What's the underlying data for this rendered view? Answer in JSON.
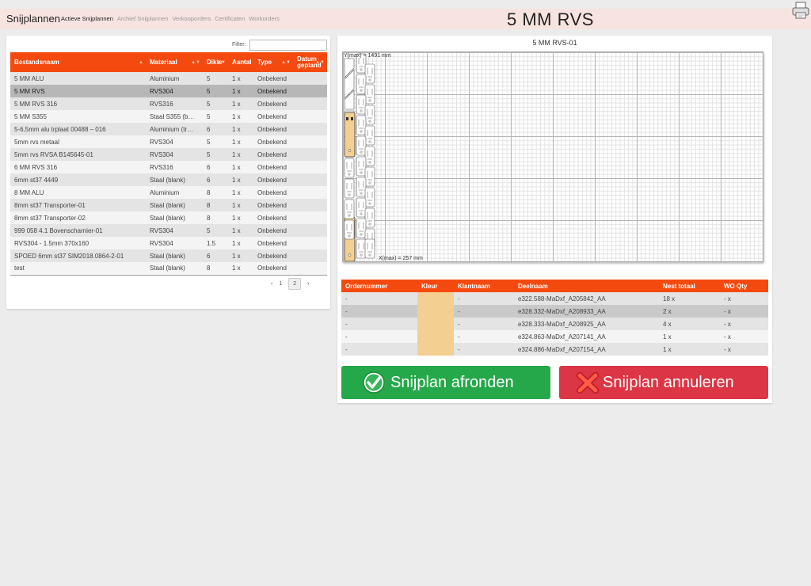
{
  "app": {
    "brand": "Snijplannen",
    "nav": [
      "Actieve Snijplannen",
      "Archief Snijplannen",
      "Verkooporders",
      "Certificaten",
      "Workorders"
    ],
    "page_title": "5 MM RVS",
    "printer_icon": "printer-icon"
  },
  "files": {
    "filter_label": "Filter:",
    "filter_value": "",
    "columns": [
      "Bestandsnaam",
      "Materiaal",
      "Dikte",
      "Aantal",
      "Type",
      "Datum gepland"
    ],
    "rows": [
      [
        "5 MM ALU",
        "Aluminium",
        "5",
        "1 x",
        "Onbekend",
        ""
      ],
      [
        "5 MM RVS",
        "RVS304",
        "5",
        "1 x",
        "Onbekend",
        ""
      ],
      [
        "5 MM RVS 316",
        "RVS316",
        "5",
        "1 x",
        "Onbekend",
        ""
      ],
      [
        "5 MM S355",
        "Staal S355 (b…",
        "5",
        "1 x",
        "Onbekend",
        ""
      ],
      [
        "5-6,5mm alu trplaat 00488 – 016",
        "Aluminium (tr…",
        "6",
        "1 x",
        "Onbekend",
        ""
      ],
      [
        "5mm rvs metaal",
        "RVS304",
        "5",
        "1 x",
        "Onbekend",
        ""
      ],
      [
        "5mm rvs RVSA B145645-01",
        "RVS304",
        "5",
        "1 x",
        "Onbekend",
        ""
      ],
      [
        "6 MM RVS 316",
        "RVS316",
        "6",
        "1 x",
        "Onbekend",
        ""
      ],
      [
        "6mm st37 4449",
        "Staal (blank)",
        "6",
        "1 x",
        "Onbekend",
        ""
      ],
      [
        "8 MM ALU",
        "Aluminium",
        "8",
        "1 x",
        "Onbekend",
        ""
      ],
      [
        "8mm st37 Transporter-01",
        "Staal (blank)",
        "8",
        "1 x",
        "Onbekend",
        ""
      ],
      [
        "8mm st37 Transporter-02",
        "Staal (blank)",
        "8",
        "1 x",
        "Onbekend",
        ""
      ],
      [
        "999 058 4.1 Bovenscharnier-01",
        "RVS304",
        "5",
        "1 x",
        "Onbekend",
        ""
      ],
      [
        "RVS304 - 1.5mm 370x160",
        "RVS304",
        "1.5",
        "1 x",
        "Onbekend",
        ""
      ],
      [
        "SPOED 6mm st37 SIM2018.0864-2-01",
        "Staal (blank)",
        "6",
        "1 x",
        "Onbekend",
        ""
      ],
      [
        "test",
        "Staal (blank)",
        "8",
        "1 x",
        "Onbekend",
        ""
      ]
    ],
    "selected_index": 1,
    "pager": {
      "prev": "‹",
      "pages": [
        "1",
        "2"
      ],
      "current": "2",
      "next": "›"
    }
  },
  "plan": {
    "title": "5 MM RVS-01",
    "ymax_label": "Y(max) = 1491 mm",
    "xmax_label": "X(max) = 257 mm",
    "part_fill": "#f3cf92"
  },
  "orders": {
    "columns": [
      "Ordernummer",
      "Kleur",
      "Klantnaam",
      "Deelnaam",
      "Nest totaal",
      "WO Qty"
    ],
    "rows": [
      [
        "-",
        "",
        "-",
        "e322.588-MaDxf_A205842_AA",
        "18 x",
        "- x"
      ],
      [
        "-",
        "",
        "-",
        "e328.332-MaDxf_A208933_AA",
        "2 x",
        "- x"
      ],
      [
        "-",
        "",
        "-",
        "e328.333-MaDxf_A208925_AA",
        "4 x",
        "- x"
      ],
      [
        "-",
        "",
        "-",
        "e324.863-MaDxf_A207141_AA",
        "1 x",
        "- x"
      ],
      [
        "-",
        "",
        "-",
        "e324.886-MaDxf_A207154_AA",
        "1 x",
        "- x"
      ]
    ],
    "selected_index": 1,
    "kleur_color": "#f3cf92"
  },
  "actions": {
    "finish_label": "Snijplan afronden",
    "finish_color": "#25a849",
    "cancel_label": "Snijplan annuleren",
    "cancel_color": "#dc3545"
  }
}
